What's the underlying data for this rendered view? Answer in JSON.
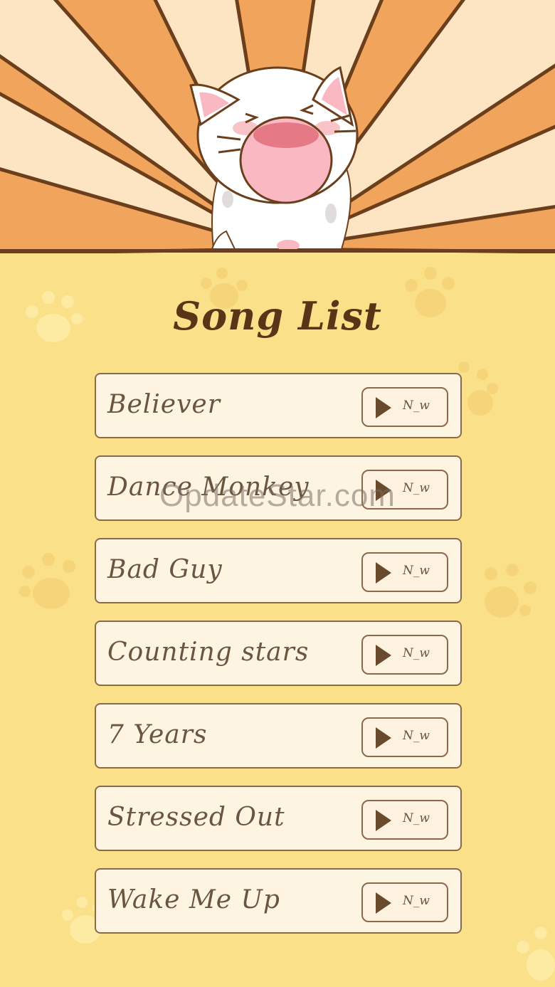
{
  "header": {
    "mascot": "singing-cat-mascot",
    "colors": {
      "ray_dark": "#f1a45c",
      "ray_light": "#fde5c3",
      "outline": "#6b3f1c"
    }
  },
  "title": "Song List",
  "songs": [
    {
      "name": "Believer",
      "button_label": "N_w"
    },
    {
      "name": "Dance Monkey",
      "button_label": "N_w"
    },
    {
      "name": "Bad Guy",
      "button_label": "N_w"
    },
    {
      "name": "Counting stars",
      "button_label": "N_w"
    },
    {
      "name": "7 Years",
      "button_label": "N_w"
    },
    {
      "name": "Stressed Out",
      "button_label": "N_w"
    },
    {
      "name": "Wake Me Up",
      "button_label": "N_w"
    }
  ],
  "watermark": "OpdateStar.com",
  "icons": {
    "play": "play-icon",
    "paw": "paw-print-icon"
  },
  "colors": {
    "background": "#fbe08a",
    "row_fill": "#fef4e2",
    "text": "#6a553e",
    "title": "#5a3416"
  }
}
